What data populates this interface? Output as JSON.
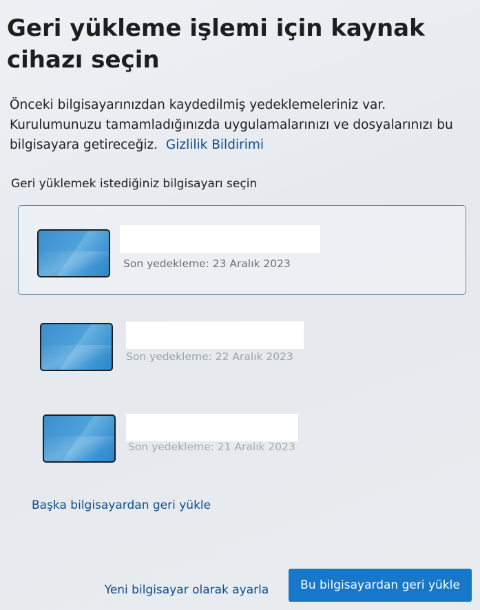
{
  "page": {
    "title": "Geri yükleme işlemi için kaynak cihazı seçin",
    "description_text": "Önceki bilgisayarınızdan kaydedilmiş yedeklemeleriniz var. Kurulumunuzu tamamladığınızda uygulamalarınızı ve dosyalarınızı bu bilgisayara getireceğiz.",
    "privacy_link": "Gizlilik Bildirimi",
    "subheading": "Geri yüklemek istediğiniz bilgisayarı seçin"
  },
  "devices": [
    {
      "backup_text": "Son yedekleme: 23 Aralık 2023",
      "selected": true
    },
    {
      "backup_text": "Son yedekleme: 22 Aralık 2023",
      "selected": false
    },
    {
      "backup_text": "Son yedekleme: 21 Aralık 2023",
      "selected": false
    }
  ],
  "other_pc_link": "Başka bilgisayardan geri yükle",
  "buttons": {
    "secondary_label": "Yeni bilgisayar olarak ayarla",
    "primary_label": "Bu bilgisayardan geri yükle"
  },
  "colors": {
    "accent": "#1778c9",
    "link": "#0a4d8c",
    "selected_border": "#5f86a8"
  },
  "icons": {
    "device_thumbnail": "laptop-screen-icon"
  }
}
